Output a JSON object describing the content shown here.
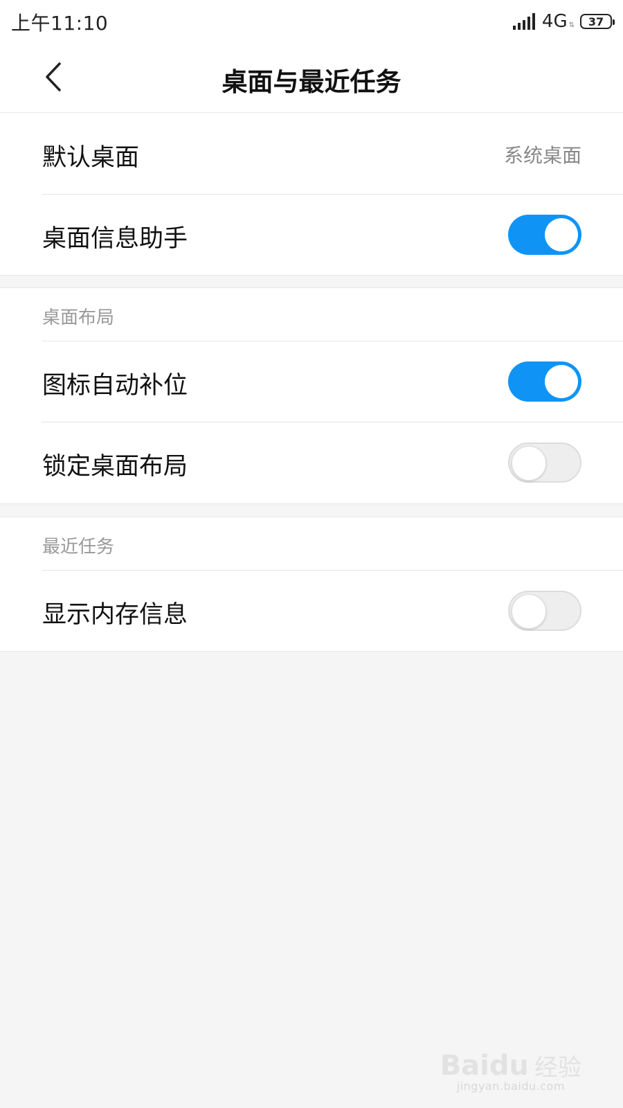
{
  "status_bar": {
    "time": "上午11:10",
    "network": "4G",
    "battery": "37",
    "icons": [
      "signal-icon",
      "data-arrows-icon",
      "battery-icon"
    ]
  },
  "header": {
    "title": "桌面与最近任务",
    "back_icon": "chevron-left-icon"
  },
  "groups": {
    "general": {
      "default_launcher": {
        "label": "默认桌面",
        "value": "系统桌面"
      },
      "info_assistant": {
        "label": "桌面信息助手",
        "enabled": true
      }
    },
    "layout": {
      "title": "桌面布局",
      "auto_fill": {
        "label": "图标自动补位",
        "enabled": true
      },
      "lock_layout": {
        "label": "锁定桌面布局",
        "enabled": false
      }
    },
    "recents": {
      "title": "最近任务",
      "memory_info": {
        "label": "显示内存信息",
        "enabled": false
      }
    }
  },
  "colors": {
    "accent": "#0f94f6",
    "background": "#f5f5f5",
    "card": "#ffffff"
  },
  "watermark": {
    "logo_text": "Baidu",
    "text": "经验",
    "url": "jingyan.baidu.com"
  }
}
